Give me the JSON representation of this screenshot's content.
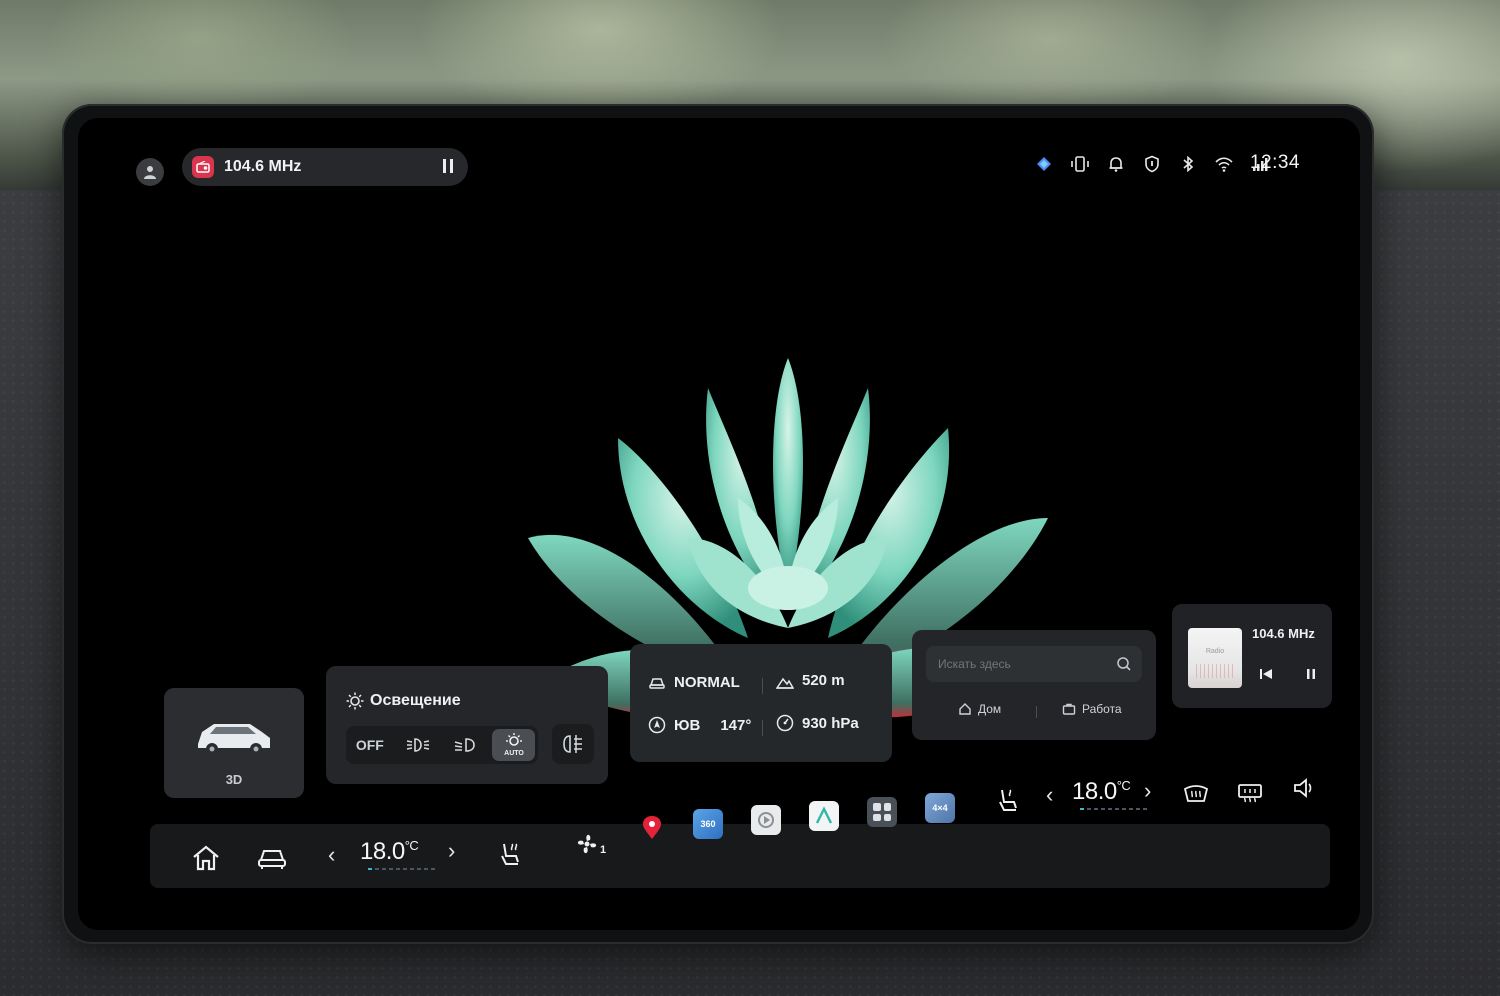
{
  "status_bar": {
    "media_frequency": "104.6 MHz",
    "clock": "12:34",
    "icons": [
      "assistant-icon",
      "phone-vibrate-icon",
      "bell-icon",
      "shield-icon",
      "bluetooth-icon",
      "wifi-icon",
      "cellular-4g-icon"
    ]
  },
  "vehicle_card": {
    "label": "3D"
  },
  "lighting": {
    "title": "Освещение",
    "options": [
      {
        "label": "OFF",
        "icon": ""
      },
      {
        "label": "",
        "icon": "parking-lights-icon"
      },
      {
        "label": "",
        "icon": "low-beam-icon"
      },
      {
        "label": "AUTO",
        "icon": "auto-light-icon",
        "active": true
      }
    ],
    "fog_icon": "rear-fog-icon"
  },
  "drive_info": {
    "mode": "NORMAL",
    "altitude": "520 m",
    "heading": "ЮВ",
    "heading_degrees": "147°",
    "pressure": "930 hPa"
  },
  "navigation": {
    "search_placeholder": "Искать здесь",
    "home_label": "Дом",
    "work_label": "Работа"
  },
  "player": {
    "frequency": "104.6 MHz",
    "art_text": "Radio"
  },
  "climate": {
    "left_temp": "18.0",
    "right_temp": "18.0",
    "unit": "°C",
    "fan_level": "1"
  },
  "dock_apps": [
    "360-camera-app",
    "media-app",
    "navigation-app",
    "apps-grid",
    "4x4-app"
  ],
  "colors": {
    "accent_teal": "#3fb6c9",
    "radio_red": "#d9354f",
    "map_pin_red": "#e4233a"
  }
}
